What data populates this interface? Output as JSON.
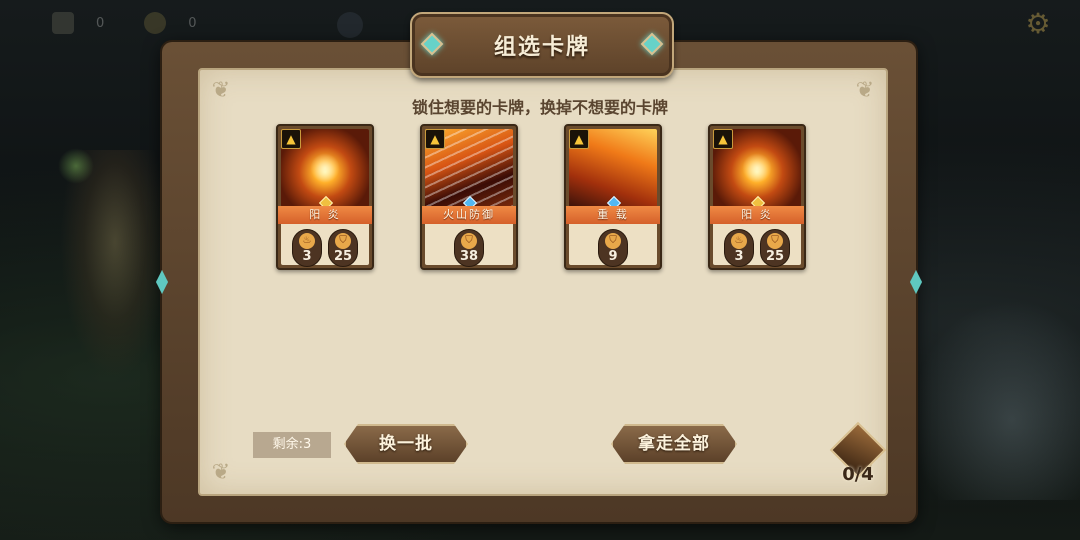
{
  "hud": {
    "counter_1": "0",
    "counter_2": "0",
    "icons": [
      "hourglass-icon",
      "coin-icon",
      "moon-icon",
      "gear-icon"
    ]
  },
  "dialog": {
    "title": "组选卡牌",
    "instruction": "锁住想要的卡牌，换掉不想要的卡牌"
  },
  "cards": [
    {
      "name": "阳 炎",
      "art": "fire",
      "gem": "gold",
      "stats": [
        {
          "icon": "fire-icon",
          "value": "3"
        },
        {
          "icon": "shield-icon",
          "value": "25"
        }
      ]
    },
    {
      "name": "火山防御",
      "art": "spear",
      "gem": "blue",
      "stats": [
        {
          "icon": "shield-icon",
          "value": "38"
        }
      ]
    },
    {
      "name": "重 载",
      "art": "lava",
      "gem": "blue",
      "stats": [
        {
          "icon": "shield-icon",
          "value": "9"
        }
      ]
    },
    {
      "name": "阳 炎",
      "art": "fire",
      "gem": "gold",
      "stats": [
        {
          "icon": "fire-icon",
          "value": "3"
        },
        {
          "icon": "shield-icon",
          "value": "25"
        }
      ]
    }
  ],
  "controls": {
    "remaining": "剩余:3",
    "reroll_label": "换一批",
    "take_all_label": "拿走全部",
    "deck_count": "0/4"
  },
  "colors": {
    "frame": "#5d4229",
    "parchment": "#e7dcc3",
    "accent_gem": "#66d2c8",
    "card_name_bar": "#d5602a"
  }
}
